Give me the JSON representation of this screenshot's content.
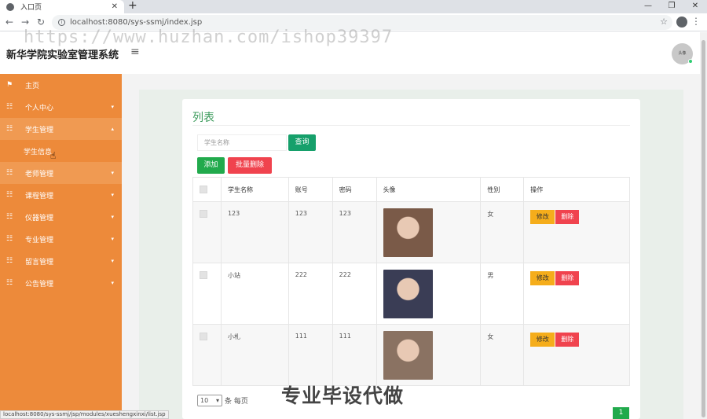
{
  "browser": {
    "tab_title": "入口页",
    "tab_close": "✕",
    "new_tab": "+",
    "url": "localhost:8080/sys-ssmj/index.jsp",
    "win_min": "—",
    "win_max": "❐",
    "win_close": "✕",
    "back": "←",
    "forward": "→",
    "reload": "↻",
    "star": "☆",
    "menu": "⋮",
    "status_url": "localhost:8080/sys-ssmj/jsp/modules/xueshengxinxi/list.jsp"
  },
  "watermark": "https://www.huzhan.com/ishop39397",
  "header": {
    "title": "新华学院实验室管理系统",
    "hamburger": "≡",
    "avatar_text": "头像"
  },
  "sidebar": {
    "items": [
      {
        "icon": "⚑",
        "label": "主页",
        "caret": ""
      },
      {
        "icon": "☷",
        "label": "个人中心",
        "caret": "▾"
      },
      {
        "icon": "☷",
        "label": "学生管理",
        "caret": "▴"
      },
      {
        "icon": "☷",
        "label": "老师管理",
        "caret": "▾"
      },
      {
        "icon": "☷",
        "label": "课程管理",
        "caret": "▾"
      },
      {
        "icon": "☷",
        "label": "仪器管理",
        "caret": "▾"
      },
      {
        "icon": "☷",
        "label": "专业管理",
        "caret": "▾"
      },
      {
        "icon": "☷",
        "label": "留言管理",
        "caret": "▾"
      },
      {
        "icon": "☷",
        "label": "公告管理",
        "caret": "▾"
      }
    ],
    "subitem": "学生信息"
  },
  "panel": {
    "title": "列表",
    "search_placeholder": "学生名称",
    "query_label": "查询",
    "add_label": "添加",
    "batch_delete_label": "批量删除"
  },
  "table": {
    "headers": [
      "",
      "学生名称",
      "账号",
      "密码",
      "头像",
      "性别",
      "操作"
    ],
    "rows": [
      {
        "name": "123",
        "account": "123",
        "password": "123",
        "gender": "女",
        "photo_color": "#7a5a48"
      },
      {
        "name": "小站",
        "account": "222",
        "password": "222",
        "gender": "男",
        "photo_color": "#3a3d55"
      },
      {
        "name": "小札",
        "account": "111",
        "password": "111",
        "gender": "女",
        "photo_color": "#8a7262"
      }
    ],
    "edit_label": "修改",
    "delete_label": "删除"
  },
  "pagination": {
    "page_size": "10",
    "page_size_suffix": "条 每页",
    "current_page": "1"
  },
  "overlay": "专业毕设代做",
  "colors": {
    "sidebar": "#ed8a3a",
    "accent_green": "#21aa4c",
    "danger": "#f0434e",
    "warning": "#f5ad1b"
  }
}
